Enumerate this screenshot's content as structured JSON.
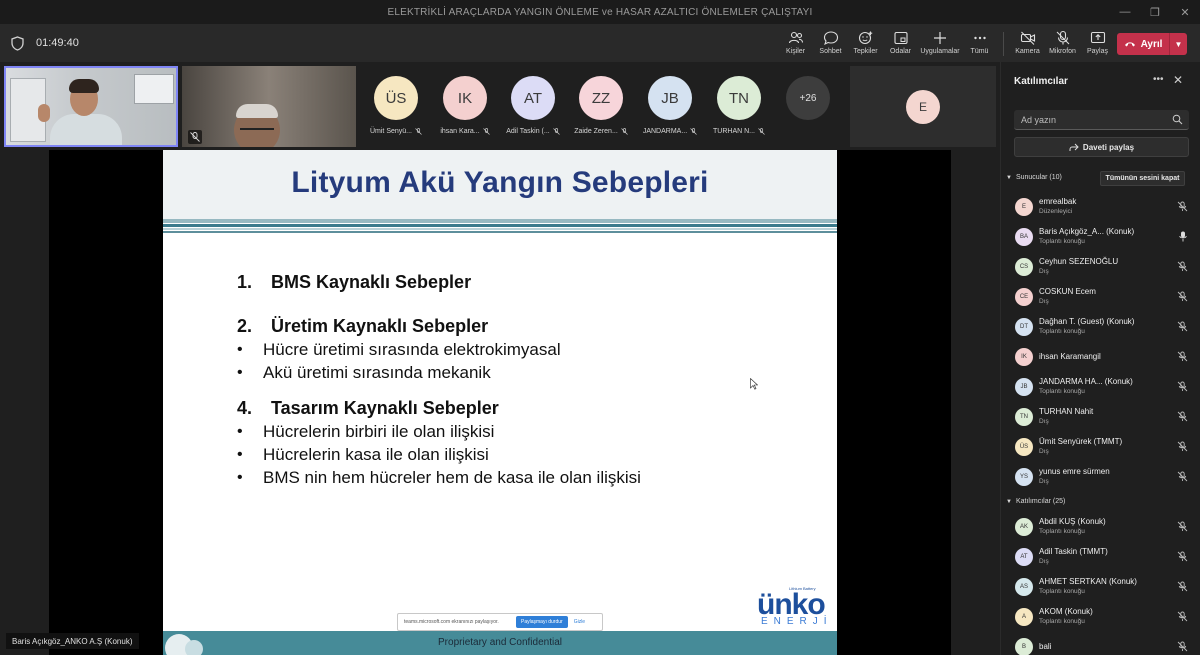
{
  "window": {
    "title": "ELEKTRİKLİ ARAÇLARDA YANGIN ÖNLEME ve HASAR AZALTICI ÖNLEMLER ÇALIŞTAYI"
  },
  "toolbar": {
    "timer": "01:49:40",
    "buttons": [
      {
        "name": "people",
        "label": "Kişiler",
        "icon": "people-icon"
      },
      {
        "name": "chat",
        "label": "Sohbet",
        "icon": "chat-icon"
      },
      {
        "name": "reactions",
        "label": "Tepkiler",
        "icon": "reactions-icon"
      },
      {
        "name": "rooms",
        "label": "Odalar",
        "icon": "rooms-icon"
      },
      {
        "name": "apps",
        "label": "Uygulamalar",
        "icon": "plus-icon"
      },
      {
        "name": "more",
        "label": "Tümü",
        "icon": "more-icon"
      },
      {
        "name": "camera",
        "label": "Kamera",
        "icon": "camera-off-icon"
      },
      {
        "name": "mic",
        "label": "Mikrofon",
        "icon": "mic-off-icon"
      },
      {
        "name": "share",
        "label": "Paylaş",
        "icon": "share-icon"
      }
    ],
    "leave_label": "Ayrıl",
    "leave_color": "#c4314b"
  },
  "gallery": {
    "tiles": [
      {
        "initials": "ÜS",
        "name": "Ümit Senyü...",
        "color": "#f6e7c1"
      },
      {
        "initials": "IK",
        "name": "ihsan Kara...",
        "color": "#f4d0cf"
      },
      {
        "initials": "AT",
        "name": "Adil Taskin (...",
        "color": "#dcdcf6"
      },
      {
        "initials": "ZZ",
        "name": "Zaide Zeren...",
        "color": "#f7d5da"
      },
      {
        "initials": "JB",
        "name": "JANDARMA...",
        "color": "#d5e2f1"
      },
      {
        "initials": "TN",
        "name": "TURHAN N...",
        "color": "#dcecd6"
      }
    ],
    "more_count": "+26",
    "extra_initial": "E"
  },
  "slide": {
    "title": "Lityum Akü Yangın Sebepleri",
    "sections": [
      {
        "num": "1.",
        "heading": "BMS Kaynaklı Sebepler",
        "bullets": []
      },
      {
        "num": "2.",
        "heading": "Üretim Kaynaklı Sebepler",
        "bullets": [
          "Hücre üretimi sırasında elektrokimyasal",
          "Akü üretimi sırasında mekanik"
        ]
      },
      {
        "num": "4.",
        "heading": "Tasarım Kaynaklı Sebepler",
        "bullets": [
          "Hücrelerin birbiri ile olan ilişkisi",
          "Hücrelerin kasa ile olan ilişkisi",
          "BMS nin hem hücreler hem de kasa ile olan ilişkisi"
        ]
      }
    ],
    "logo_brand": "ünko",
    "logo_tiny": "Lithium Battery",
    "logo_sub": "ENERJİ",
    "footer": "Proprietary and Confidential"
  },
  "share_bar": {
    "text": "teams.microsoft.com ekranınızı paylaşıyor.",
    "stop_label": "Paylaşmayı durdur",
    "hide_label": "Gizle"
  },
  "presenter_label": "Baris Açıkgöz_ANKO A.Ş (Konuk)",
  "panel": {
    "title": "Katılımcılar",
    "search_placeholder": "Ad yazın",
    "invite_label": "Daveti paylaş",
    "presenters_label": "Sunucular (10)",
    "mute_all_label": "Tümünün sesini kapat",
    "attendees_label": "Katılımcılar (25)",
    "presenters": [
      {
        "initials": "E",
        "name": "emrealbak",
        "role": "Düzenleyici",
        "color": "#f4d6d0",
        "mic": "off"
      },
      {
        "initials": "BA",
        "name": "Baris Açıkgöz_A... (Konuk)",
        "role": "Toplantı konuğu",
        "color": "#e9dbf1",
        "mic": "on"
      },
      {
        "initials": "CS",
        "name": "Ceyhun SEZENOĞLU",
        "role": "Dış",
        "color": "#dcecd6",
        "mic": "off"
      },
      {
        "initials": "CE",
        "name": "COSKUN Ecem",
        "role": "Dış",
        "color": "#f4d0cf",
        "mic": "off"
      },
      {
        "initials": "DT",
        "name": "Dağhan T. (Guest) (Konuk)",
        "role": "Toplantı konuğu",
        "color": "#d5e2f1",
        "mic": "off"
      },
      {
        "initials": "IK",
        "name": "ihsan Karamangil",
        "role": "",
        "color": "#f4d0cf",
        "mic": "off"
      },
      {
        "initials": "JB",
        "name": "JANDARMA HA... (Konuk)",
        "role": "Toplantı konuğu",
        "color": "#d5e2f1",
        "mic": "off"
      },
      {
        "initials": "TN",
        "name": "TURHAN Nahit",
        "role": "Dış",
        "color": "#dcecd6",
        "mic": "off"
      },
      {
        "initials": "ÜS",
        "name": "Ümit Senyürek (TMMT)",
        "role": "Dış",
        "color": "#f6e7c1",
        "mic": "off"
      },
      {
        "initials": "YS",
        "name": "yunus emre sürmen",
        "role": "Dış",
        "color": "#d5e2f1",
        "mic": "off"
      }
    ],
    "attendees": [
      {
        "initials": "AK",
        "name": "Abdil KUŞ (Konuk)",
        "role": "Toplantı konuğu",
        "color": "#dcecd6",
        "mic": "off"
      },
      {
        "initials": "AT",
        "name": "Adil Taskin (TMMT)",
        "role": "Dış",
        "color": "#dcdcf6",
        "mic": "off"
      },
      {
        "initials": "AS",
        "name": "AHMET SERTKAN (Konuk)",
        "role": "Toplantı konuğu",
        "color": "#d5e8ec",
        "mic": "off"
      },
      {
        "initials": "A",
        "name": "AKOM (Konuk)",
        "role": "Toplantı konuğu",
        "color": "#f6e7c1",
        "mic": "off"
      },
      {
        "initials": "B",
        "name": "bali",
        "role": "",
        "color": "#dcecd6",
        "mic": "off"
      }
    ]
  }
}
